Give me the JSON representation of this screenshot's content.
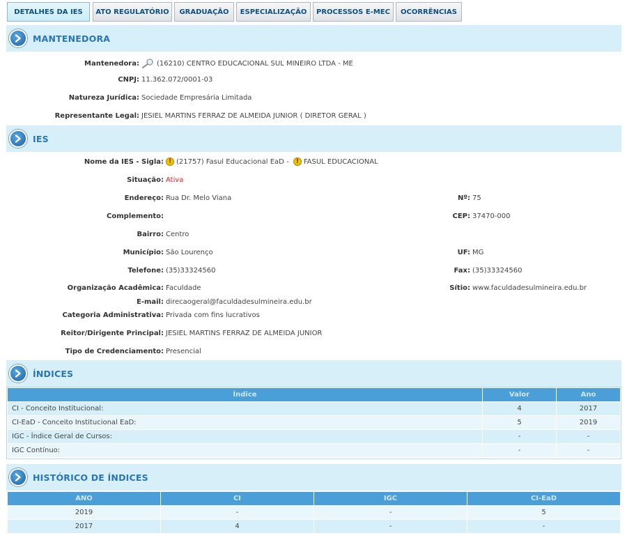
{
  "tabs": [
    {
      "label": "DETALHES DA IES"
    },
    {
      "label": "ATO REGULATÓRIO"
    },
    {
      "label": "GRADUAÇÃO"
    },
    {
      "label": "ESPECIALIZAÇÃO"
    },
    {
      "label": "PROCESSOS E-MEC"
    },
    {
      "label": "OCORRÊNCIAS"
    }
  ],
  "mantenedora": {
    "title": "MANTENEDORA",
    "fields": {
      "mantenedora_label": "Mantenedora:",
      "mantenedora_value": "(16210) CENTRO EDUCACIONAL SUL MINEIRO LTDA - ME",
      "cnpj_label": "CNPJ:",
      "cnpj_value": "11.362.072/0001-03",
      "natureza_label": "Natureza Jurídica:",
      "natureza_value": "Sociedade Empresária Limitada",
      "representante_label": "Representante Legal:",
      "representante_value": "JESIEL MARTINS FERRAZ DE ALMEIDA JUNIOR ( DIRETOR GERAL )"
    }
  },
  "ies": {
    "title": "IES",
    "fields": {
      "nome_label": "Nome da IES - Sigla:",
      "nome_value": "(21757) Fasul Educacional EaD -",
      "sigla_value": "FASUL EDUCACIONAL",
      "situacao_label": "Situação:",
      "situacao_value": "Ativa",
      "endereco_label": "Endereço:",
      "endereco_value": "Rua Dr. Melo Viana",
      "numero_label": "Nº:",
      "numero_value": "75",
      "complemento_label": "Complemento:",
      "complemento_value": "",
      "cep_label": "CEP:",
      "cep_value": "37470-000",
      "bairro_label": "Bairro:",
      "bairro_value": "Centro",
      "municipio_label": "Município:",
      "municipio_value": "São Lourenço",
      "uf_label": "UF:",
      "uf_value": "MG",
      "telefone_label": "Telefone:",
      "telefone_value": "(35)33324560",
      "fax_label": "Fax:",
      "fax_value": "(35)33324560",
      "org_label": "Organização Acadêmica:",
      "org_value": "Faculdade",
      "sitio_label": "Sítio:",
      "sitio_value": "www.faculdadesulmineira.edu.br",
      "email_label": "E-mail:",
      "email_value": "direcaogeral@faculdadesulmineira.edu.br",
      "categoria_label": "Categoria Administrativa:",
      "categoria_value": "Privada com fins lucrativos",
      "reitor_label": "Reitor/Dirigente Principal:",
      "reitor_value": "JESIEL MARTINS FERRAZ DE ALMEIDA JUNIOR",
      "credenciamento_label": "Tipo de Credenciamento:",
      "credenciamento_value": "Presencial"
    }
  },
  "indices": {
    "title": "ÍNDICES",
    "headers": [
      "Índice",
      "Valor",
      "Ano"
    ],
    "rows": [
      [
        "CI - Conceito Institucional:",
        "4",
        "2017"
      ],
      [
        "CI-EaD - Conceito Institucional EaD:",
        "5",
        "2019"
      ],
      [
        "IGC - Índice Geral de Cursos:",
        "-",
        "-"
      ],
      [
        "IGC Contínuo:",
        "-",
        "-"
      ]
    ]
  },
  "historico": {
    "title": "HISTÓRICO DE ÍNDICES",
    "headers": [
      "ANO",
      "CI",
      "IGC",
      "CI-EaD"
    ],
    "rows": [
      [
        "2019",
        "-",
        "-",
        "5"
      ],
      [
        "2017",
        "4",
        "-",
        "-"
      ]
    ]
  },
  "colors": {
    "accent": "#2a75b5",
    "header_bg": "#d6eff8",
    "table_header": "#4a9fd8",
    "status_active": "#e02020"
  },
  "icons": {
    "section_arrow": "chevron-right-circle-icon",
    "lookup": "magnifier-icon",
    "warning": "warning-icon"
  }
}
